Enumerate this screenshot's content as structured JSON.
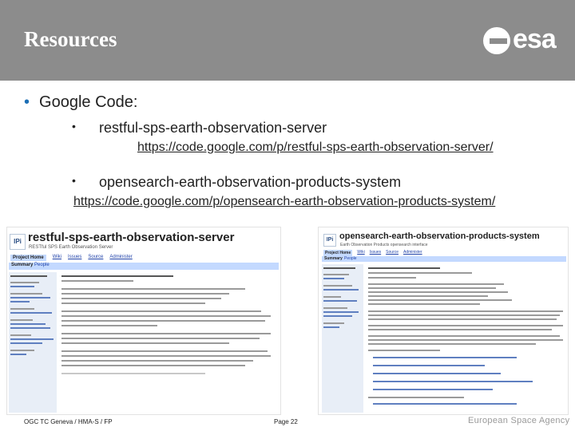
{
  "header": {
    "title": "Resources",
    "logo_text": "esa",
    "background": "#8c8c8c"
  },
  "main": {
    "bullet": "Google Code:",
    "items": [
      {
        "name": "restful-sps-earth-observation-server",
        "url": "https://code.google.com/p/restful-sps-earth-observation-server/"
      },
      {
        "name": "opensearch-earth-observation-products-system",
        "url": "https://code.google.com/p/opensearch-earth-observation-products-system/"
      }
    ]
  },
  "screenshots": [
    {
      "logo": "IPi",
      "title": "restful-sps-earth-observation-server",
      "subtitle": "RESTful SPS Earth Observation Server",
      "tabs": [
        "Project Home",
        "Wiki",
        "Issues",
        "Source",
        "Administer"
      ],
      "subtabs": [
        "Summary",
        "People"
      ]
    },
    {
      "logo": "IPi",
      "title": "opensearch-earth-observation-products-system",
      "subtitle": "Earth Observation Products opensearch interface",
      "tabs": [
        "Project Home",
        "Wiki",
        "Issues",
        "Source",
        "Administer"
      ],
      "subtabs": [
        "Summary",
        "People"
      ]
    }
  ],
  "footer": {
    "left": "OGC TC Geneva / HMA-S / FP",
    "page": "Page 22",
    "agency": "European Space Agency"
  }
}
